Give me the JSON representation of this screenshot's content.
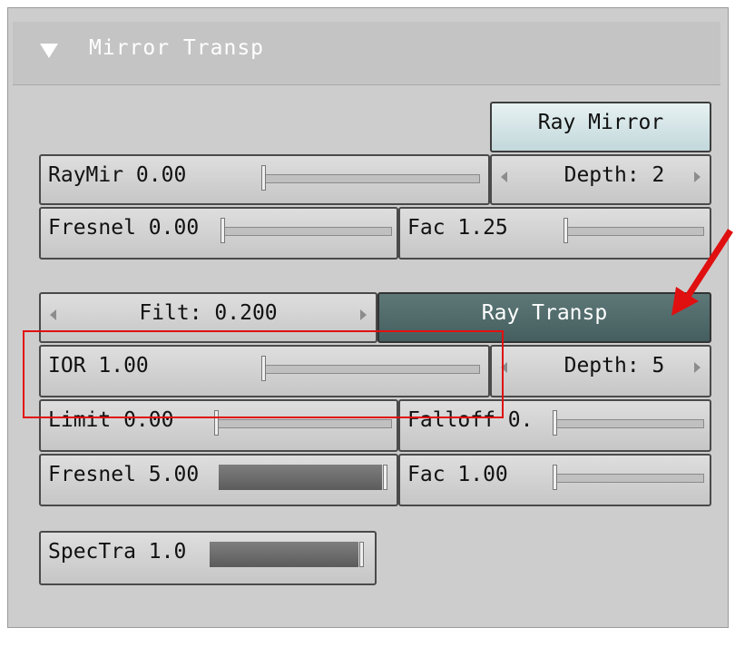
{
  "panel": {
    "title": "Mirror Transp",
    "collapse_icon": "triangle-down-icon"
  },
  "mirror": {
    "ray_mirror_label": "Ray Mirror",
    "raymir": {
      "label": "RayMir 0.00",
      "value": 0.0
    },
    "depth": {
      "label": "Depth: 2"
    },
    "fresnel": {
      "label": "Fresnel 0.00",
      "value": 0.0
    },
    "fac": {
      "label": "Fac 1.25"
    }
  },
  "transp": {
    "filt": {
      "label": "Filt: 0.200"
    },
    "ray_transp_label": "Ray Transp",
    "ior": {
      "label": "IOR 1.00"
    },
    "depth": {
      "label": "Depth: 5"
    },
    "limit": {
      "label": "Limit 0.00"
    },
    "falloff": {
      "label": "Falloff 0."
    },
    "fresnel": {
      "label": "Fresnel 5.00",
      "value": 1.0
    },
    "fac": {
      "label": "Fac 1.00"
    }
  },
  "spectra": {
    "label": "SpecTra 1.0",
    "value": 1.0
  },
  "annotations": {
    "highlight_color": "#e01010",
    "arrow_color": "#e01010"
  }
}
